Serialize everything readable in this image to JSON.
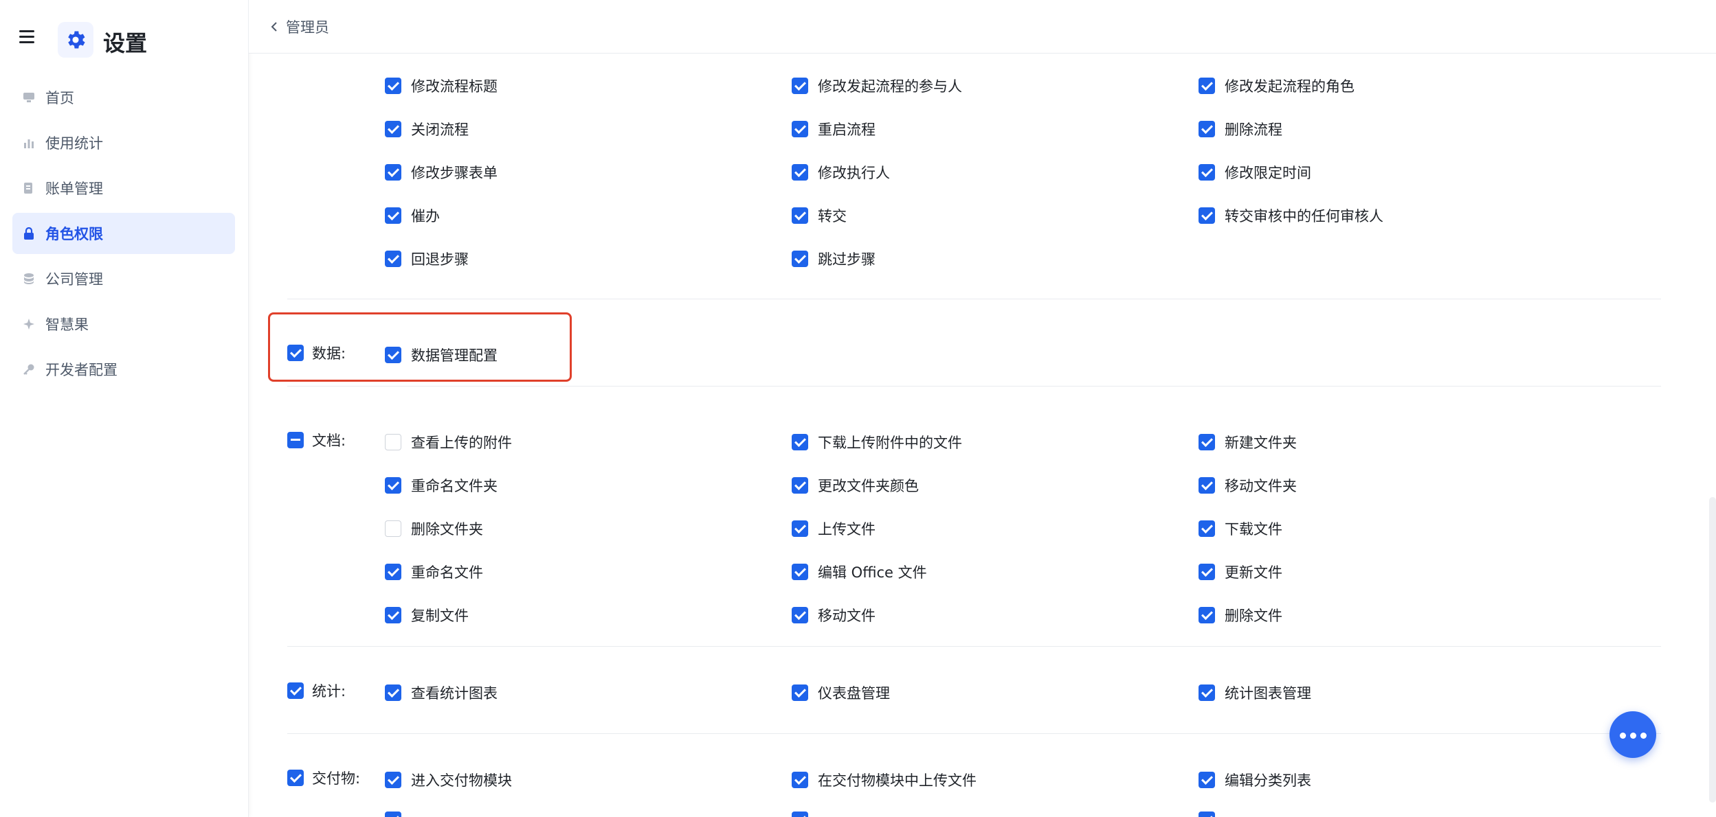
{
  "app": {
    "title": "设置"
  },
  "sidebar": {
    "items": [
      {
        "label": "首页",
        "icon": "monitor-icon",
        "active": false
      },
      {
        "label": "使用统计",
        "icon": "bar-chart-icon",
        "active": false
      },
      {
        "label": "账单管理",
        "icon": "bill-icon",
        "active": false
      },
      {
        "label": "角色权限",
        "icon": "lock-icon",
        "active": true
      },
      {
        "label": "公司管理",
        "icon": "database-icon",
        "active": false
      },
      {
        "label": "智慧果",
        "icon": "sparkle-icon",
        "active": false
      },
      {
        "label": "开发者配置",
        "icon": "key-icon",
        "active": false
      }
    ]
  },
  "topbar": {
    "back_label": "管理员"
  },
  "flow": {
    "rows": [
      [
        "修改流程标题",
        "修改发起流程的参与人",
        "修改发起流程的角色"
      ],
      [
        "关闭流程",
        "重启流程",
        "删除流程"
      ],
      [
        "修改步骤表单",
        "修改执行人",
        "修改限定时间"
      ],
      [
        "催办",
        "转交",
        "转交审核中的任何审核人"
      ],
      [
        "回退步骤",
        "跳过步骤"
      ]
    ]
  },
  "data_section": {
    "label": "数据:",
    "items": [
      "数据管理配置"
    ]
  },
  "docs": {
    "label": "文档:",
    "rows": [
      [
        {
          "label": "查看上传的附件",
          "checked": false
        },
        {
          "label": "下载上传附件中的文件",
          "checked": true
        },
        {
          "label": "新建文件夹",
          "checked": true
        }
      ],
      [
        {
          "label": "重命名文件夹",
          "checked": true
        },
        {
          "label": "更改文件夹颜色",
          "checked": true
        },
        {
          "label": "移动文件夹",
          "checked": true
        }
      ],
      [
        {
          "label": "删除文件夹",
          "checked": false
        },
        {
          "label": "上传文件",
          "checked": true
        },
        {
          "label": "下载文件",
          "checked": true
        }
      ],
      [
        {
          "label": "重命名文件",
          "checked": true
        },
        {
          "label": "编辑 Office 文件",
          "checked": true
        },
        {
          "label": "更新文件",
          "checked": true
        }
      ],
      [
        {
          "label": "复制文件",
          "checked": true
        },
        {
          "label": "移动文件",
          "checked": true
        },
        {
          "label": "删除文件",
          "checked": true
        }
      ]
    ]
  },
  "stats": {
    "label": "统计:",
    "items": [
      "查看统计图表",
      "仪表盘管理",
      "统计图表管理"
    ]
  },
  "deliverables": {
    "label": "交付物:",
    "items": [
      "进入交付物模块",
      "在交付物模块中上传文件",
      "编辑分类列表"
    ]
  },
  "colors": {
    "accent": "#1e63ea",
    "highlight": "#e0402b",
    "active_bg": "#e9efff"
  }
}
